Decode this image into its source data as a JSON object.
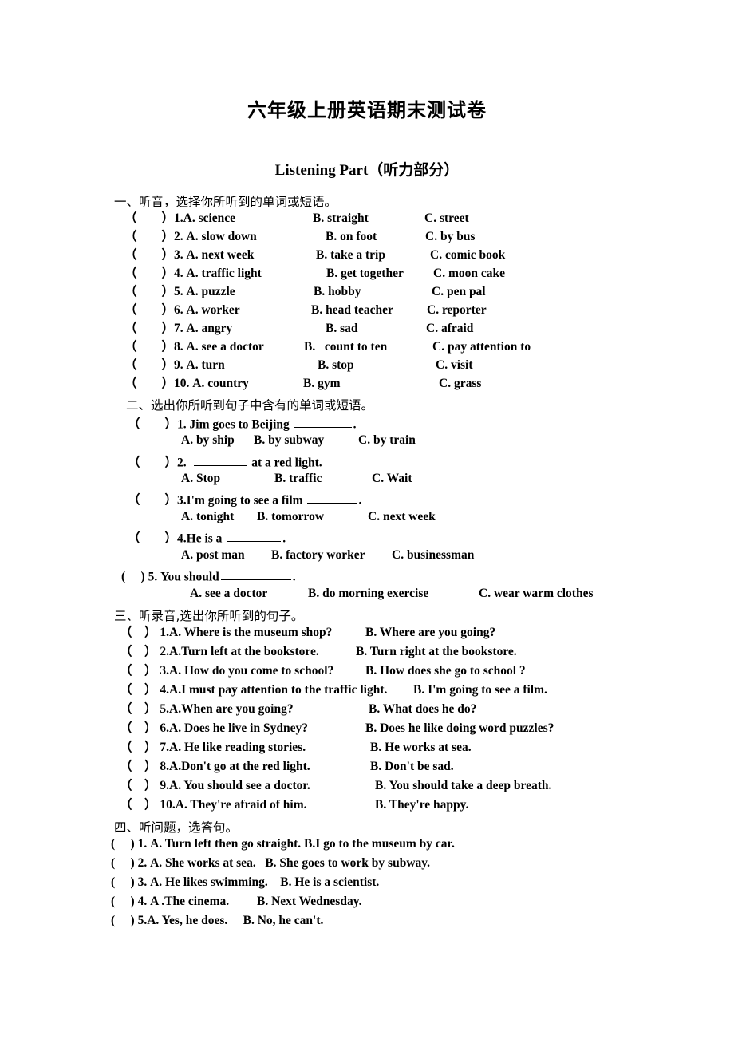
{
  "document": {
    "title": "六年级上册英语期末测试卷",
    "part_title": "Listening Part（听力部分）"
  },
  "sections": [
    {
      "id": "section-1",
      "heading": "一、听音，选择你所听到的单词或短语。",
      "paren_open": "（",
      "paren_close": "）",
      "questions": [
        {
          "num": "1.",
          "a": "A. science",
          "b": "B. straight",
          "c": "C. street"
        },
        {
          "num": "2.",
          "a": "A. slow down",
          "b": "B. on foot",
          "c": "C. by bus"
        },
        {
          "num": "3.",
          "a": "A. next week",
          "b": "B. take a trip",
          "c": "C. comic book"
        },
        {
          "num": "4.",
          "a": "A. traffic light",
          "b": "B. get together",
          "c": "C. moon cake"
        },
        {
          "num": "5.",
          "a": "A. puzzle",
          "b": "B. hobby",
          "c": "C. pen pal"
        },
        {
          "num": "6.",
          "a": "A. worker",
          "b": "B. head teacher",
          "c": "C. reporter"
        },
        {
          "num": "7.",
          "a": "A. angry",
          "b": "B. sad",
          "c": "C. afraid"
        },
        {
          "num": "8.",
          "a": "A. see a doctor",
          "b": "B.   count to ten",
          "c": "C. pay attention to"
        },
        {
          "num": "9.",
          "a": "A. turn",
          "b": "B. stop",
          "c": "C. visit"
        },
        {
          "num": "10.",
          "a": "A. country",
          "b": "B. gym",
          "c": "C. grass"
        }
      ]
    },
    {
      "id": "section-2",
      "heading": "二、选出你所听到句子中含有的单词或短语。",
      "questions": [
        {
          "num": "1.",
          "stem_before": "Jim goes to Beijing ",
          "stem_after": ".",
          "a": "A. by ship",
          "b": "B. by subway",
          "c": "C. by train"
        },
        {
          "num": "2.",
          "stem_before": "",
          "stem_after": "at a red light.",
          "a": "A. Stop",
          "b": "B. traffic",
          "c": "C. Wait"
        },
        {
          "num": "3.",
          "stem_before": "I'm going to see a film ",
          "stem_after": ".",
          "a": "A. tonight",
          "b": "B. tomorrow",
          "c": "C. next week"
        },
        {
          "num": "4.",
          "stem_before": "He is a ",
          "stem_after": ".",
          "a": "A. post man",
          "b": "B. factory worker",
          "c": "C. businessman"
        },
        {
          "num": "5.",
          "stem_before": "You should",
          "stem_after": ".",
          "a": "A. see a doctor",
          "b": "B. do morning exercise",
          "c": "C. wear warm clothes"
        }
      ]
    },
    {
      "id": "section-3",
      "heading": "三、听录音,选出你所听到的句子。",
      "questions": [
        {
          "num": "1.",
          "a": "A. Where is the museum shop?",
          "b": "B. Where are you going?"
        },
        {
          "num": "2.",
          "a": "A.Turn left at the bookstore.",
          "b": "B. Turn right at the bookstore."
        },
        {
          "num": "3.",
          "a": "A. How do you come to school?",
          "b": "B. How does she go to school ?"
        },
        {
          "num": "4.",
          "a": "A.I must pay attention to the traffic light.",
          "b": "B. I'm going to see a film."
        },
        {
          "num": "5.",
          "a": "A.When are you going?",
          "b": "B. What does he do?"
        },
        {
          "num": "6.",
          "a": "A. Does he live in Sydney?",
          "b": "B. Does he like doing word puzzles?"
        },
        {
          "num": "7.",
          "a": "A. He like reading stories.",
          "b": "B. He works at sea."
        },
        {
          "num": "8.",
          "a": "A.Don't go at the red light.",
          "b": "B. Don't be sad."
        },
        {
          "num": "9.",
          "a": "A. You should see a doctor.",
          "b": "B. You should take a deep breath."
        },
        {
          "num": "10.",
          "a": "A. They're afraid of him.",
          "b": "B. They're happy."
        }
      ]
    },
    {
      "id": "section-4",
      "heading": "四、听问题，选答句。",
      "questions": [
        {
          "num": "1.",
          "a": "A. Turn left then go straight.",
          "b": "B.I go to the museum by car."
        },
        {
          "num": "2.",
          "a": "A. She works at sea.",
          "b": "B. She goes to work by subway."
        },
        {
          "num": "3.",
          "a": "A. He likes swimming.",
          "b": "B. He is a scientist."
        },
        {
          "num": "4.",
          "a": "A .The cinema.",
          "b": "B. Next Wednesday."
        },
        {
          "num": "5.",
          "a": "A. Yes, he does.",
          "b": "B. No, he can't."
        }
      ]
    }
  ]
}
